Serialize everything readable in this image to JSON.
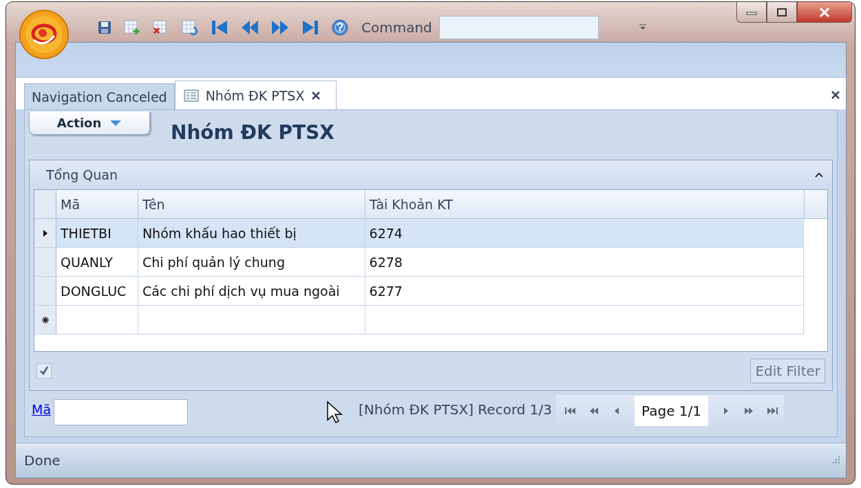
{
  "window": {
    "command_label": "Command"
  },
  "tabs": [
    {
      "label": "Navigation Canceled",
      "selected": false,
      "closable": false
    },
    {
      "label": "Nhóm ĐK PTSX",
      "selected": true,
      "closable": true
    }
  ],
  "action_button": "Action",
  "page_title": "Nhóm ĐK PTSX",
  "group": {
    "title": "Tổng Quan",
    "expanded": true
  },
  "table": {
    "columns": [
      "Mã",
      "Tên",
      "Tài Khoản KT"
    ],
    "rows": [
      {
        "cells": [
          "THIETBI",
          "Nhóm khấu hao thiết bị",
          "6274"
        ],
        "selected": true
      },
      {
        "cells": [
          "QUANLY",
          "Chi phí quản lý chung",
          "6278"
        ],
        "selected": false
      },
      {
        "cells": [
          "DONGLUC",
          "Các chi phí dịch vụ mua ngoài",
          "6277"
        ],
        "selected": false
      }
    ],
    "new_row": true
  },
  "filter": {
    "checked": true,
    "button": "Edit Filter"
  },
  "search": {
    "label": "Mã"
  },
  "record_text": "[Nhóm ĐK PTSX] Record 1/3",
  "pager": {
    "page": "Page 1/1"
  },
  "status_bar": "Done"
}
